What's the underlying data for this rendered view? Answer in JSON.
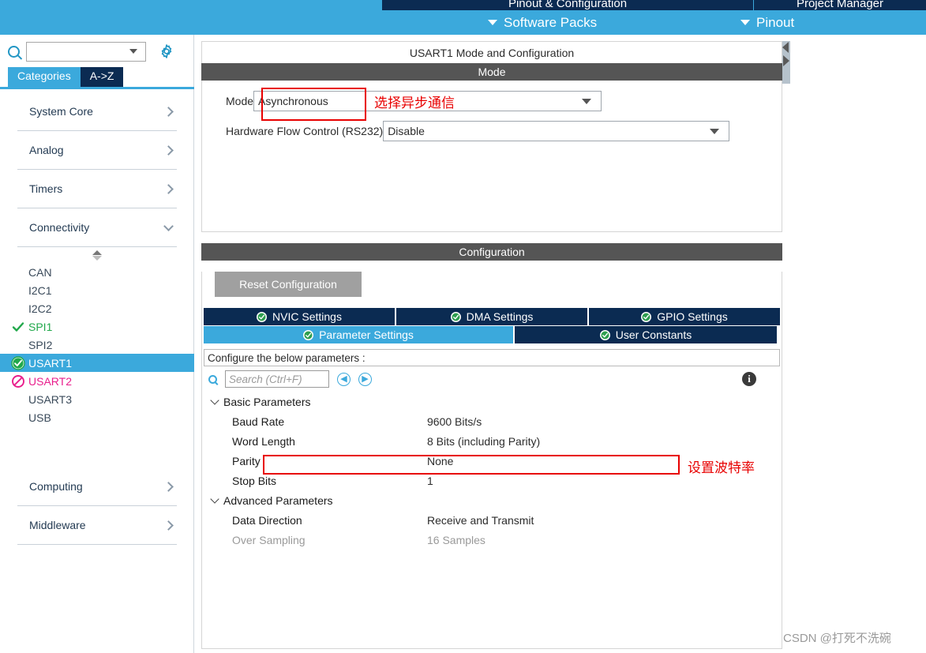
{
  "topnav": {
    "dark_tabs": [
      {
        "label": "Pinout & Configuration"
      },
      {
        "label": "Project Manager"
      }
    ],
    "items": [
      {
        "label": "Software Packs",
        "icon": "chevron-down-icon"
      },
      {
        "label": "Pinout",
        "icon": "chevron-down-icon"
      }
    ]
  },
  "sidebar": {
    "search": {
      "value": "",
      "placeholder": ""
    },
    "gear_icon": "gear-icon",
    "search_icon": "search-icon",
    "tabs": [
      {
        "label": "Categories",
        "active": true
      },
      {
        "label": "A->Z",
        "active": false
      }
    ],
    "categories": [
      {
        "label": "System Core",
        "expanded": false
      },
      {
        "label": "Analog",
        "expanded": false
      },
      {
        "label": "Timers",
        "expanded": false
      },
      {
        "label": "Connectivity",
        "expanded": true
      }
    ],
    "peripherals": [
      {
        "label": "CAN",
        "state": "none"
      },
      {
        "label": "I2C1",
        "state": "none"
      },
      {
        "label": "I2C2",
        "state": "none"
      },
      {
        "label": "SPI1",
        "state": "check"
      },
      {
        "label": "SPI2",
        "state": "none"
      },
      {
        "label": "USART1",
        "state": "configured",
        "selected": true
      },
      {
        "label": "USART2",
        "state": "blocked"
      },
      {
        "label": "USART3",
        "state": "none"
      },
      {
        "label": "USB",
        "state": "none"
      }
    ],
    "categories_bottom": [
      {
        "label": "Computing",
        "expanded": false
      },
      {
        "label": "Middleware",
        "expanded": false
      }
    ]
  },
  "main": {
    "panel_title": "USART1 Mode and Configuration",
    "mode_section": {
      "header": "Mode",
      "fields": [
        {
          "label": "Mode",
          "value": "Asynchronous"
        },
        {
          "label": "Hardware Flow Control (RS232)",
          "value": "Disable"
        }
      ],
      "annotation": "选择异步通信"
    },
    "configuration_section": {
      "header": "Configuration",
      "reset_button": "Reset Configuration",
      "tabs_row1": [
        {
          "label": "NVIC Settings",
          "active": false
        },
        {
          "label": "DMA Settings",
          "active": false
        },
        {
          "label": "GPIO Settings",
          "active": false
        }
      ],
      "tabs_row2": [
        {
          "label": "Parameter Settings",
          "active": true
        },
        {
          "label": "User Constants",
          "active": false
        }
      ],
      "configure_hint": "Configure the below parameters :",
      "search": {
        "value": "",
        "placeholder": "Search (Ctrl+F)"
      },
      "nav_prev_icon": "chevron-left-circle-icon",
      "nav_next_icon": "chevron-right-circle-icon",
      "info_icon": "info-icon",
      "groups": [
        {
          "label": "Basic Parameters",
          "expanded": true,
          "rows": [
            {
              "name": "Baud Rate",
              "value": "9600 Bits/s",
              "highlighted": true,
              "dimmed": false
            },
            {
              "name": "Word Length",
              "value": "8 Bits (including Parity)",
              "highlighted": false,
              "dimmed": false
            },
            {
              "name": "Parity",
              "value": "None",
              "highlighted": false,
              "dimmed": false
            },
            {
              "name": "Stop Bits",
              "value": "1",
              "highlighted": false,
              "dimmed": false
            }
          ]
        },
        {
          "label": "Advanced Parameters",
          "expanded": true,
          "rows": [
            {
              "name": "Data Direction",
              "value": "Receive and Transmit",
              "highlighted": false,
              "dimmed": false
            },
            {
              "name": "Over Sampling",
              "value": "16 Samples",
              "highlighted": false,
              "dimmed": true
            }
          ]
        }
      ],
      "annotation": "设置波特率"
    }
  },
  "watermark": "CSDN @打死不洗碗",
  "colors": {
    "accent_blue": "#3BA9DC",
    "dark_navy": "#0B2B52",
    "header_gray": "#555555",
    "annotation_red": "#E80000",
    "ok_green": "#21A84B",
    "warn_pink": "#E91E8C"
  }
}
